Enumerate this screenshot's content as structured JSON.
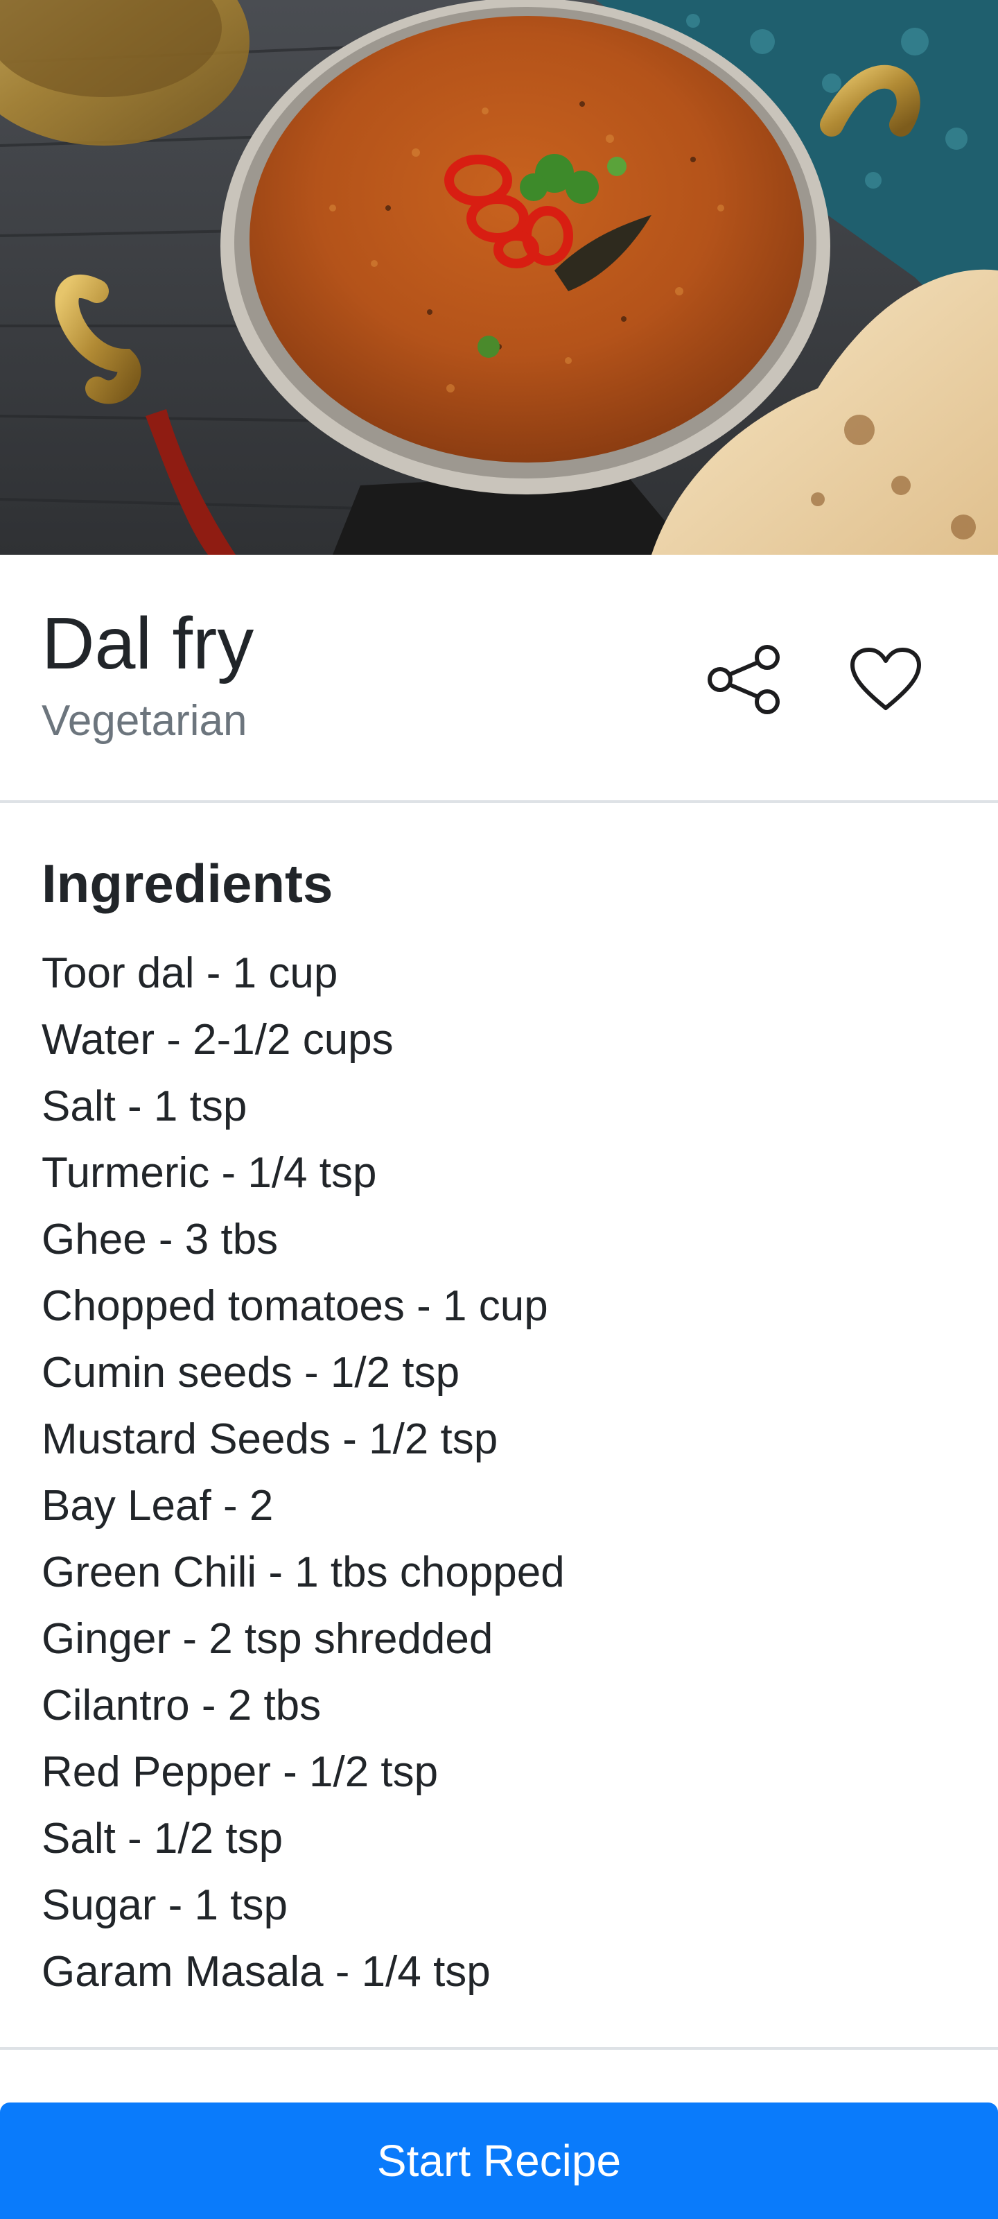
{
  "hero": {
    "image_subject": "Bowl of dal fry garnished with red chili slices and cilantro, with naan bread on the side"
  },
  "recipe": {
    "title": "Dal fry",
    "category": "Vegetarian"
  },
  "actions": {
    "share_icon": "share-icon",
    "favorite_icon": "heart-outline-icon"
  },
  "ingredients": {
    "heading": "Ingredients",
    "items": [
      "Toor dal - 1 cup",
      "Water - 2-1/2 cups",
      "Salt - 1 tsp",
      "Turmeric - 1/4 tsp",
      "Ghee - 3 tbs",
      "Chopped tomatoes - 1 cup",
      "Cumin seeds - 1/2 tsp",
      "Mustard Seeds - 1/2 tsp",
      "Bay Leaf - 2",
      "Green Chili - 1 tbs chopped",
      "Ginger - 2 tsp shredded",
      "Cilantro - 2 tbs",
      "Red Pepper - 1/2 tsp",
      "Salt - 1/2 tsp",
      "Sugar - 1 tsp",
      "Garam Masala - 1/4 tsp"
    ]
  },
  "footer": {
    "start_label": "Start Recipe"
  },
  "colors": {
    "primary": "#0a7bfb",
    "muted_text": "#6c757d",
    "divider": "#dee2e6"
  }
}
